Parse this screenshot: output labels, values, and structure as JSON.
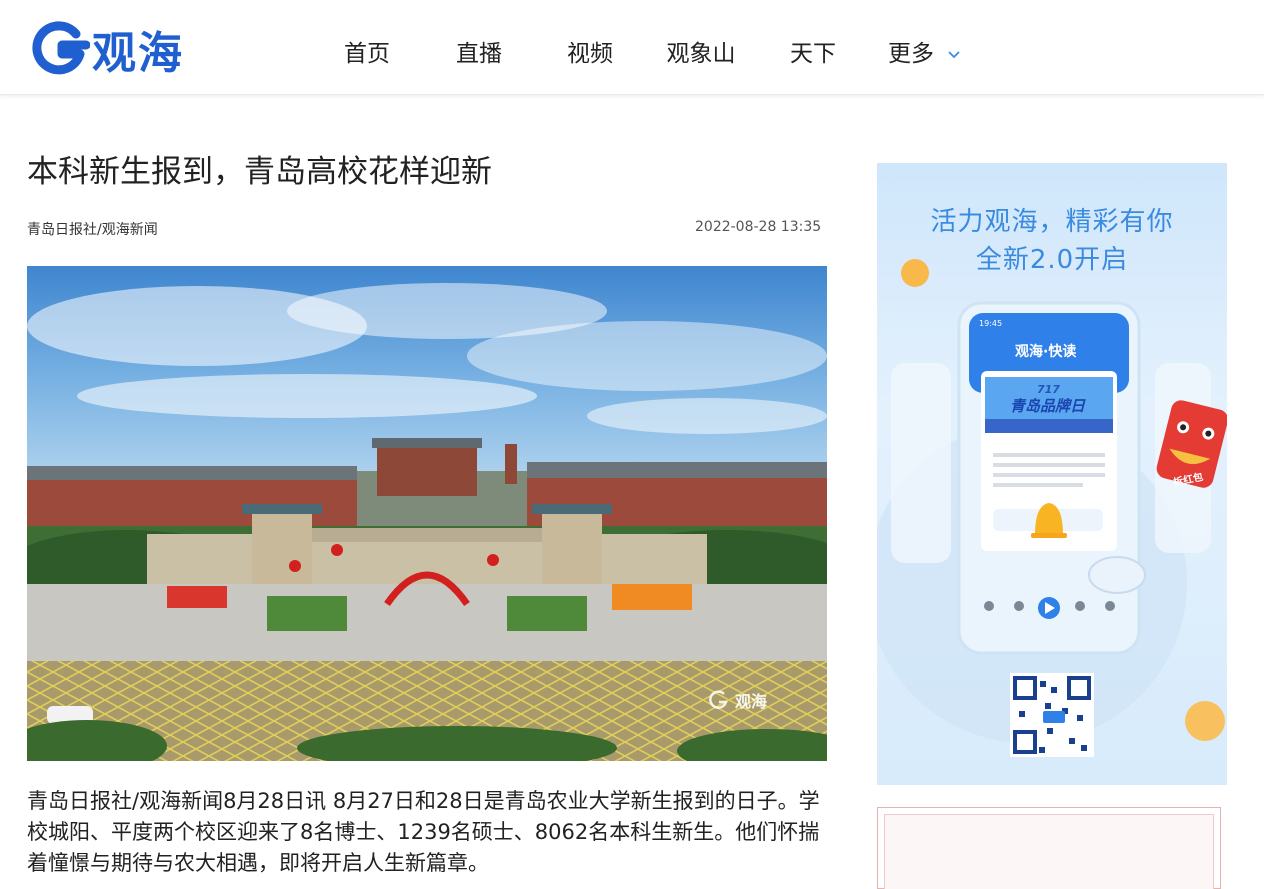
{
  "site": {
    "logo_text": "观海"
  },
  "nav": {
    "items": [
      "首页",
      "直播",
      "视频",
      "观象山",
      "天下",
      "更多"
    ]
  },
  "article": {
    "title": "本科新生报到，青岛高校花样迎新",
    "source": "青岛日报社/观海新闻",
    "time": "2022-08-28 13:35",
    "photo_watermark": "观海",
    "body": "青岛日报社/观海新闻8月28日讯 8月27日和28日是青岛农业大学新生报到的日子。学校城阳、平度两个校区迎来了8名博士、1239名硕士、8062名本科生新生。他们怀揣着憧憬与期待与农大相遇，即将开启人生新篇章。"
  },
  "ad": {
    "line1": "活力观海，精彩有你",
    "line2": "全新2.0开启",
    "phone_time": "19:45",
    "phone_brand": "观海·快读",
    "banner_number": "717",
    "banner_title": "青岛品牌日",
    "redbag_label": "拆红包"
  },
  "colors": {
    "brand_blue": "#1f5fd0",
    "ad_text_blue": "#3a8be0"
  }
}
